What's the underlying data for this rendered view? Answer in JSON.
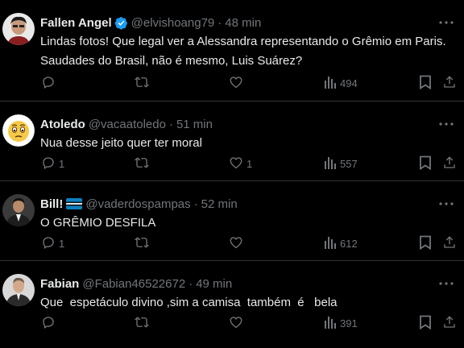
{
  "colors": {
    "background": "#000000",
    "text": "#e7e9ea",
    "muted": "#71767b",
    "divider": "#2f3336",
    "verified_blue": "#1d9bf0"
  },
  "tweets": [
    {
      "name": "Fallen Angel",
      "handle": "@elvishoang79",
      "separator": "·",
      "time": "48 min",
      "verified": true,
      "text": "Lindas fotos! Que legal ver a Alessandra representando o Grêmio em Paris.\nSaudades do Brasil, não é mesmo, Luis Suárez?",
      "replies": "",
      "reposts": "",
      "likes": "",
      "views": "494",
      "icons": [
        "reply-icon",
        "repost-icon",
        "like-icon",
        "views-icon",
        "bookmark-icon",
        "share-icon"
      ]
    },
    {
      "name": "Atoledo",
      "handle": "@vacaatoledo",
      "separator": "·",
      "time": "51 min",
      "verified": false,
      "text": "Nua desse jeito quer ter moral",
      "replies": "1",
      "reposts": "",
      "likes": "1",
      "views": "557",
      "icons": [
        "reply-icon",
        "repost-icon",
        "like-icon",
        "views-icon",
        "bookmark-icon",
        "share-icon"
      ]
    },
    {
      "name": "Bill!",
      "handle": "@vaderdospampas",
      "separator": "·",
      "time": "52 min",
      "verified": false,
      "flag": "gremio-flag-icon",
      "text": "O GRÊMIO DESFILA",
      "replies": "1",
      "reposts": "",
      "likes": "",
      "views": "612",
      "icons": [
        "reply-icon",
        "repost-icon",
        "like-icon",
        "views-icon",
        "bookmark-icon",
        "share-icon"
      ]
    },
    {
      "name": "Fabian",
      "handle": "@Fabian46522672",
      "separator": "·",
      "time": "49 min",
      "verified": false,
      "text": "Que  espetáculo divino ,sim a camisa  também  é   bela",
      "replies": "",
      "reposts": "",
      "likes": "",
      "views": "391",
      "icons": [
        "reply-icon",
        "repost-icon",
        "like-icon",
        "views-icon",
        "bookmark-icon",
        "share-icon"
      ]
    }
  ]
}
